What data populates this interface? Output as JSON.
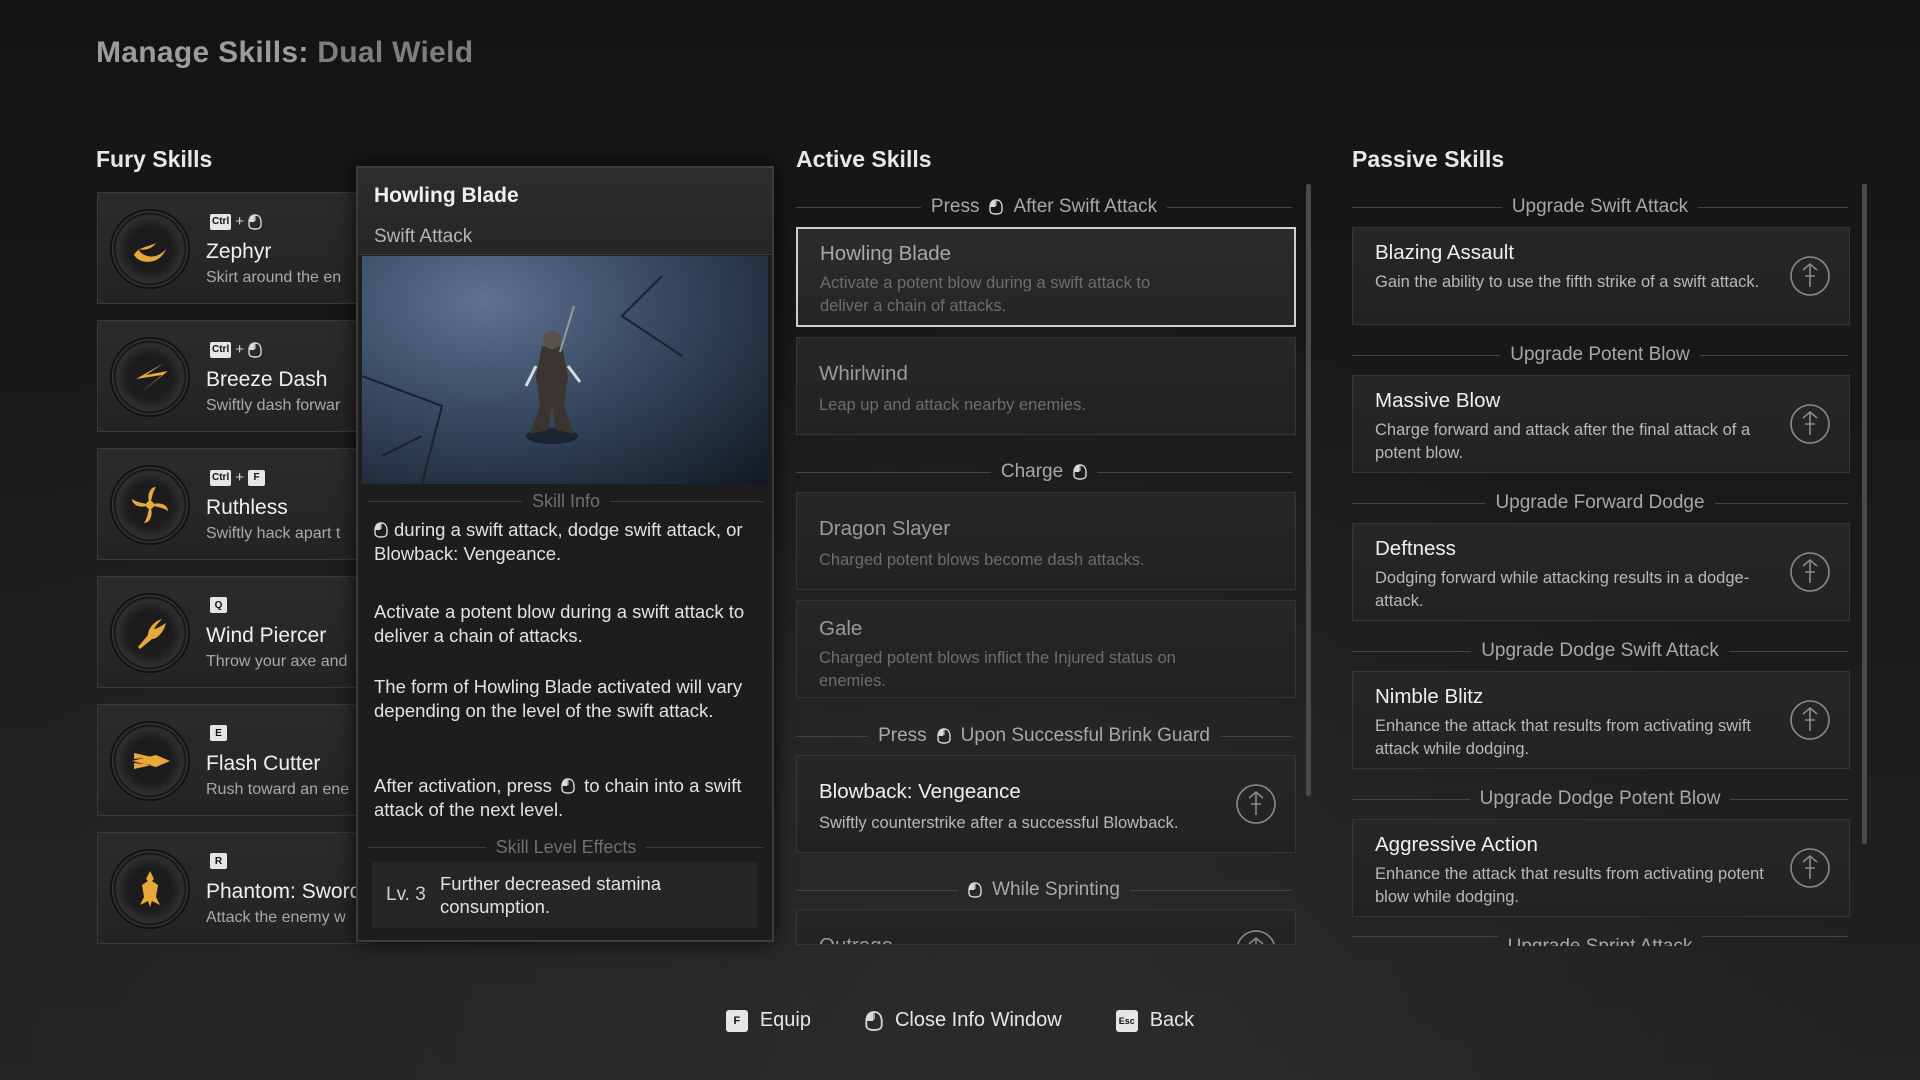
{
  "title": {
    "main": "Manage Skills:",
    "sub": "Dual Wield"
  },
  "headers": {
    "fury": "Fury Skills",
    "active": "Active Skills",
    "passive": "Passive Skills"
  },
  "fury": [
    {
      "keys": [
        "Ctrl",
        "+",
        "mouse-icon"
      ],
      "name": "Zephyr",
      "desc": "Skirt around the en",
      "icon": "crescent-slash-icon"
    },
    {
      "keys": [
        "Ctrl",
        "+",
        "mouse-icon"
      ],
      "name": "Breeze Dash",
      "desc": "Swiftly dash forwar",
      "icon": "dash-slash-icon"
    },
    {
      "keys": [
        "Ctrl",
        "+",
        "F"
      ],
      "name": "Ruthless",
      "desc": "Swiftly hack apart t",
      "icon": "spiral-blades-icon"
    },
    {
      "keys": [
        "Q"
      ],
      "name": "Wind Piercer",
      "desc": "Throw your axe and",
      "icon": "wind-axe-icon"
    },
    {
      "keys": [
        "E"
      ],
      "name": "Flash Cutter",
      "desc": "Rush toward an ene",
      "icon": "flash-cut-icon"
    },
    {
      "keys": [
        "R"
      ],
      "name": "Phantom: Sword",
      "desc": "Attack the enemy w",
      "icon": "phantom-warrior-icon"
    }
  ],
  "info": {
    "title": "Howling Blade",
    "type": "Swift Attack",
    "skill_info_label": "Skill Info",
    "p1": "during a swift attack, dodge swift attack, or Blowback: Vengeance.",
    "p2": "Activate a potent blow during a swift attack to deliver a chain of attacks.",
    "p3": "The form of Howling Blade activated will vary depending on the level of the swift attack.",
    "p4a": "After activation, press",
    "p4b": "to chain into a swift attack of the next level.",
    "level_label": "Skill Level Effects",
    "level_tag": "Lv. 3",
    "level_text": "Further decreased stamina consumption."
  },
  "active": {
    "groups": [
      {
        "pre": "Press",
        "post": "After Swift Attack"
      },
      {
        "pre": "Charge",
        "post": ""
      },
      {
        "pre": "Press",
        "post": "Upon Successful Brink Guard"
      },
      {
        "pre": "",
        "post": "While Sprinting"
      }
    ],
    "skills": [
      {
        "name": "Howling Blade",
        "desc": "Activate a potent blow during a swift attack to deliver a chain of attacks."
      },
      {
        "name": "Whirlwind",
        "desc": "Leap up and attack nearby enemies."
      },
      {
        "name": "Dragon Slayer",
        "desc": "Charged potent blows become dash attacks."
      },
      {
        "name": "Gale",
        "desc": "Charged potent blows inflict the Injured status on enemies."
      },
      {
        "name": "Blowback: Vengeance",
        "desc": "Swiftly counterstrike after a successful Blowback."
      },
      {
        "name": "Outrage",
        "desc": ""
      }
    ]
  },
  "passive": {
    "groups": [
      "Upgrade Swift Attack",
      "Upgrade Potent Blow",
      "Upgrade Forward Dodge",
      "Upgrade Dodge Swift Attack",
      "Upgrade Dodge Potent Blow",
      "Upgrade Sprint Attack"
    ],
    "skills": [
      {
        "name": "Blazing Assault",
        "desc": "Gain the ability to use the fifth strike of a swift attack."
      },
      {
        "name": "Massive Blow",
        "desc": "Charge forward and attack after the final attack of a potent blow."
      },
      {
        "name": "Deftness",
        "desc": "Dodging forward while attacking results in a dodge-attack."
      },
      {
        "name": "Nimble Blitz",
        "desc": "Enhance the attack that results from activating swift attack while dodging."
      },
      {
        "name": "Aggressive Action",
        "desc": "Enhance the attack that results from activating potent blow while dodging."
      }
    ]
  },
  "bottom": {
    "equip_key": "F",
    "equip": "Equip",
    "close": "Close Info Window",
    "back_key": "Esc",
    "back": "Back"
  },
  "colors": {
    "accent_gold": "#e8a93a",
    "panel": "#1d1d1d",
    "selected_border": "#cfcfcf"
  }
}
